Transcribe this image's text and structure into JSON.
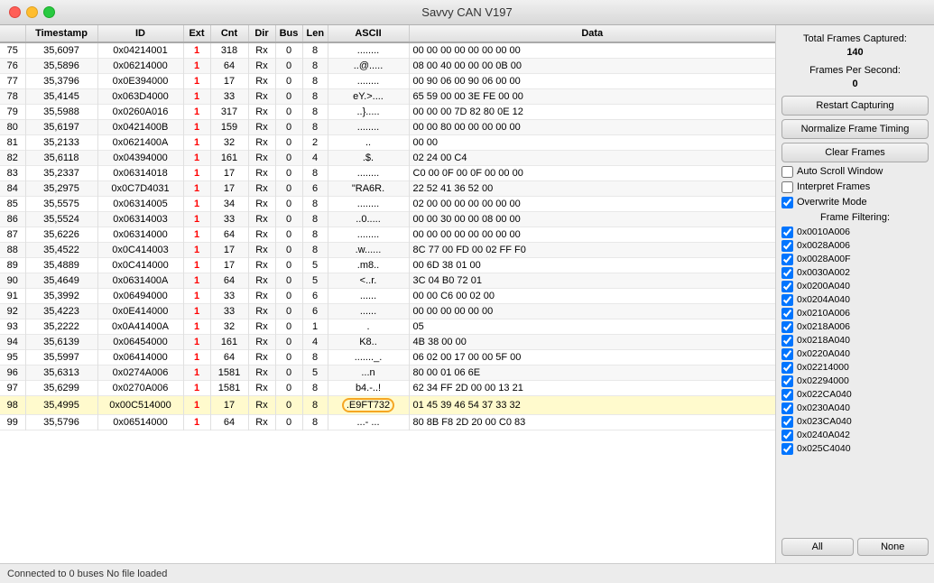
{
  "titleBar": {
    "title": "Savvy CAN V197"
  },
  "sidebar": {
    "totalFramesCapturedLabel": "Total Frames Captured:",
    "totalFramesCaptured": "140",
    "framesPerSecondLabel": "Frames Per Second:",
    "framesPerSecond": "0",
    "restartCapturingLabel": "Restart Capturing",
    "normalizeFrameTimingLabel": "Normalize Frame Timing",
    "clearFramesLabel": "Clear Frames",
    "autoScrollWindowLabel": "Auto Scroll Window",
    "interpretFramesLabel": "Interpret Frames",
    "overwriteModeLabel": "Overwrite Mode",
    "overwriteModeChecked": true,
    "frameFFilteringLabel": "Frame Filtering:",
    "allLabel": "All",
    "noneLabel": "None",
    "filters": [
      {
        "label": "0x0010A006",
        "checked": true
      },
      {
        "label": "0x0028A006",
        "checked": true
      },
      {
        "label": "0x0028A00F",
        "checked": true
      },
      {
        "label": "0x0030A002",
        "checked": true
      },
      {
        "label": "0x0200A040",
        "checked": true
      },
      {
        "label": "0x0204A040",
        "checked": true
      },
      {
        "label": "0x0210A006",
        "checked": true
      },
      {
        "label": "0x0218A006",
        "checked": true
      },
      {
        "label": "0x0218A040",
        "checked": true
      },
      {
        "label": "0x0220A040",
        "checked": true
      },
      {
        "label": "0x02214000",
        "checked": true
      },
      {
        "label": "0x02294000",
        "checked": true
      },
      {
        "label": "0x022CA040",
        "checked": true
      },
      {
        "label": "0x0230A040",
        "checked": true
      },
      {
        "label": "0x023CA040",
        "checked": true
      },
      {
        "label": "0x0240A042",
        "checked": true
      },
      {
        "label": "0x025C4040",
        "checked": true
      }
    ]
  },
  "table": {
    "columns": [
      "",
      "Timestamp",
      "ID",
      "Ext",
      "Cnt",
      "Dir",
      "Bus",
      "Len",
      "ASCII",
      "Data"
    ],
    "rows": [
      {
        "num": "75",
        "ts": "35,6097",
        "id": "0x04214001",
        "ext": "1",
        "cnt": "318",
        "dir": "Rx",
        "bus": "0",
        "len": "8",
        "ascii": "........",
        "data": "00 00 00 00 00 00 00 00"
      },
      {
        "num": "76",
        "ts": "35,5896",
        "id": "0x06214000",
        "ext": "1",
        "cnt": "64",
        "dir": "Rx",
        "bus": "0",
        "len": "8",
        "ascii": "..@.....",
        "data": "08 00 40 00 00 00 0B 00"
      },
      {
        "num": "77",
        "ts": "35,3796",
        "id": "0x0E394000",
        "ext": "1",
        "cnt": "17",
        "dir": "Rx",
        "bus": "0",
        "len": "8",
        "ascii": "........",
        "data": "00 90 06 00 90 06 00 00"
      },
      {
        "num": "78",
        "ts": "35,4145",
        "id": "0x063D4000",
        "ext": "1",
        "cnt": "33",
        "dir": "Rx",
        "bus": "0",
        "len": "8",
        "ascii": "eY.>....",
        "data": "65 59 00 00 3E FE 00 00"
      },
      {
        "num": "79",
        "ts": "35,5988",
        "id": "0x0260A016",
        "ext": "1",
        "cnt": "317",
        "dir": "Rx",
        "bus": "0",
        "len": "8",
        "ascii": "..}.....",
        "data": "00 00 00 7D 82 80 0E 12"
      },
      {
        "num": "80",
        "ts": "35,6197",
        "id": "0x0421400B",
        "ext": "1",
        "cnt": "159",
        "dir": "Rx",
        "bus": "0",
        "len": "8",
        "ascii": "........",
        "data": "00 00 80 00 00 00 00 00"
      },
      {
        "num": "81",
        "ts": "35,2133",
        "id": "0x0621400A",
        "ext": "1",
        "cnt": "32",
        "dir": "Rx",
        "bus": "0",
        "len": "2",
        "ascii": "..",
        "data": "00 00"
      },
      {
        "num": "82",
        "ts": "35,6118",
        "id": "0x04394000",
        "ext": "1",
        "cnt": "161",
        "dir": "Rx",
        "bus": "0",
        "len": "4",
        "ascii": ".$.",
        "data": "02 24 00 C4"
      },
      {
        "num": "83",
        "ts": "35,2337",
        "id": "0x06314018",
        "ext": "1",
        "cnt": "17",
        "dir": "Rx",
        "bus": "0",
        "len": "8",
        "ascii": "........",
        "data": "C0 00 0F 00 0F 00 00 00"
      },
      {
        "num": "84",
        "ts": "35,2975",
        "id": "0x0C7D4031",
        "ext": "1",
        "cnt": "17",
        "dir": "Rx",
        "bus": "0",
        "len": "6",
        "ascii": "\"RA6R.",
        "data": "22 52 41 36 52 00"
      },
      {
        "num": "85",
        "ts": "35,5575",
        "id": "0x06314005",
        "ext": "1",
        "cnt": "34",
        "dir": "Rx",
        "bus": "0",
        "len": "8",
        "ascii": "........",
        "data": "02 00 00 00 00 00 00 00"
      },
      {
        "num": "86",
        "ts": "35,5524",
        "id": "0x06314003",
        "ext": "1",
        "cnt": "33",
        "dir": "Rx",
        "bus": "0",
        "len": "8",
        "ascii": "..0.....",
        "data": "00 00 30 00 00 08 00 00"
      },
      {
        "num": "87",
        "ts": "35,6226",
        "id": "0x06314000",
        "ext": "1",
        "cnt": "64",
        "dir": "Rx",
        "bus": "0",
        "len": "8",
        "ascii": "........",
        "data": "00 00 00 00 00 00 00 00"
      },
      {
        "num": "88",
        "ts": "35,4522",
        "id": "0x0C414003",
        "ext": "1",
        "cnt": "17",
        "dir": "Rx",
        "bus": "0",
        "len": "8",
        "ascii": ".w......",
        "data": "8C 77 00 FD 00 02 FF F0"
      },
      {
        "num": "89",
        "ts": "35,4889",
        "id": "0x0C414000",
        "ext": "1",
        "cnt": "17",
        "dir": "Rx",
        "bus": "0",
        "len": "5",
        "ascii": ".m8..",
        "data": "00 6D 38 01 00"
      },
      {
        "num": "90",
        "ts": "35,4649",
        "id": "0x0631400A",
        "ext": "1",
        "cnt": "64",
        "dir": "Rx",
        "bus": "0",
        "len": "5",
        "ascii": "<..r.",
        "data": "3C 04 B0 72 01"
      },
      {
        "num": "91",
        "ts": "35,3992",
        "id": "0x06494000",
        "ext": "1",
        "cnt": "33",
        "dir": "Rx",
        "bus": "0",
        "len": "6",
        "ascii": "......",
        "data": "00 00 C6 00 02 00"
      },
      {
        "num": "92",
        "ts": "35,4223",
        "id": "0x0E414000",
        "ext": "1",
        "cnt": "33",
        "dir": "Rx",
        "bus": "0",
        "len": "6",
        "ascii": "......",
        "data": "00 00 00 00 00 00"
      },
      {
        "num": "93",
        "ts": "35,2222",
        "id": "0x0A41400A",
        "ext": "1",
        "cnt": "32",
        "dir": "Rx",
        "bus": "0",
        "len": "1",
        "ascii": ".",
        "data": "05"
      },
      {
        "num": "94",
        "ts": "35,6139",
        "id": "0x06454000",
        "ext": "1",
        "cnt": "161",
        "dir": "Rx",
        "bus": "0",
        "len": "4",
        "ascii": "K8..",
        "data": "4B 38 00 00"
      },
      {
        "num": "95",
        "ts": "35,5997",
        "id": "0x06414000",
        "ext": "1",
        "cnt": "64",
        "dir": "Rx",
        "bus": "0",
        "len": "8",
        "ascii": "......._.",
        "data": "06 02 00 17 00 00 5F 00"
      },
      {
        "num": "96",
        "ts": "35,6313",
        "id": "0x0274A006",
        "ext": "1",
        "cnt": "1581",
        "dir": "Rx",
        "bus": "0",
        "len": "5",
        "ascii": "...n",
        "data": "80 00 01 06 6E"
      },
      {
        "num": "97",
        "ts": "35,6299",
        "id": "0x0270A006",
        "ext": "1",
        "cnt": "1581",
        "dir": "Rx",
        "bus": "0",
        "len": "8",
        "ascii": "b4.-..!",
        "data": "62 34 FF 2D 00 00 13 21"
      },
      {
        "num": "98",
        "ts": "35,4995",
        "id": "0x00C514000",
        "ext": "1",
        "cnt": "17",
        "dir": "Rx",
        "bus": "0",
        "len": "8",
        "ascii": ".E9FT732",
        "data": "01 45 39 46 54 37 33 32",
        "highlighted": true
      },
      {
        "num": "99",
        "ts": "35,5796",
        "id": "0x06514000",
        "ext": "1",
        "cnt": "64",
        "dir": "Rx",
        "bus": "0",
        "len": "8",
        "ascii": "...- ...",
        "data": "80 8B F8 2D 20 00 C0 83"
      }
    ]
  },
  "statusBar": {
    "text": "Connected to 0 buses  No file loaded"
  }
}
